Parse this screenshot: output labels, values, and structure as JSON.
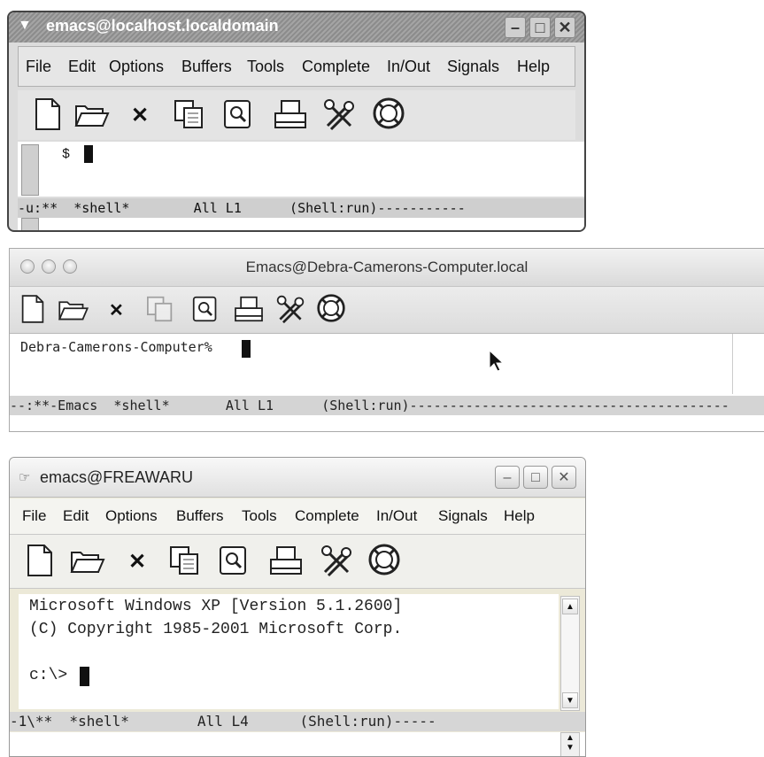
{
  "window_linux": {
    "title": "emacs@localhost.localdomain",
    "menu": [
      "File",
      "Edit",
      "Options",
      "Buffers",
      "Tools",
      "Complete",
      "In/Out",
      "Signals",
      "Help"
    ],
    "prompt": "$",
    "modeline": "-u:**  *shell*        All L1      (Shell:run)-----------"
  },
  "window_mac": {
    "title": "Emacs@Debra-Camerons-Computer.local",
    "prompt": "Debra-Camerons-Computer%",
    "modeline": "--:**-Emacs  *shell*       All L1      (Shell:run)----------------------------------------"
  },
  "window_xp": {
    "title": "emacs@FREAWARU",
    "menu": [
      "File",
      "Edit",
      "Options",
      "Buffers",
      "Tools",
      "Complete",
      "In/Out",
      "Signals",
      "Help"
    ],
    "lines": [
      "Microsoft Windows XP [Version 5.1.2600]",
      "(C) Copyright 1985-2001 Microsoft Corp.",
      "",
      "c:\\>"
    ],
    "modeline": "-1\\**  *shell*        All L4      (Shell:run)-----"
  },
  "toolbar_icons": [
    "new-file-icon",
    "open-folder-icon",
    "close-icon",
    "copy-icon",
    "find-icon",
    "print-icon",
    "preferences-icon",
    "help-icon"
  ]
}
